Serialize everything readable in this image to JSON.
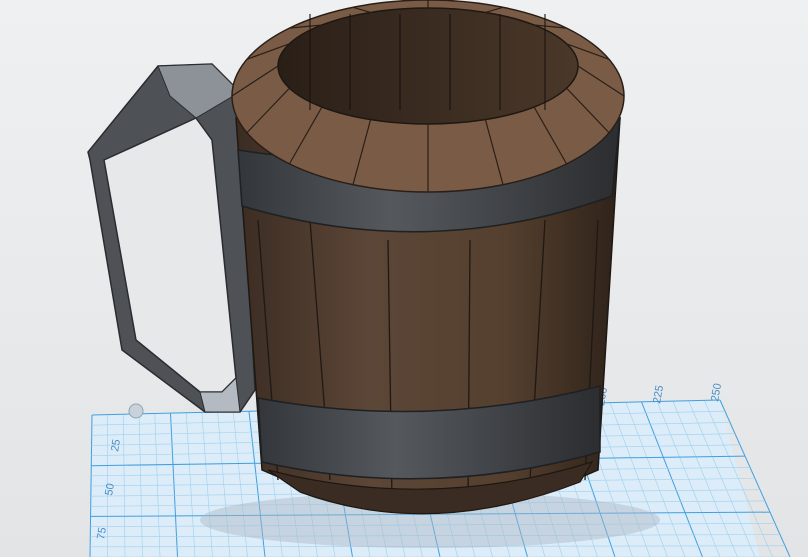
{
  "viewport": {
    "name": "3D design workspace",
    "background": "#e6e8ea"
  },
  "grid": {
    "color_minor": "#9fd0ef",
    "color_major": "#3f9fe0",
    "fill": "#dcecf8",
    "labels": [
      "25",
      "50",
      "75",
      "200",
      "225",
      "250"
    ]
  },
  "model": {
    "name": "Wooden tankard",
    "wood_color": "#5a4434",
    "rim_color": "#7a5c46",
    "band_color": "#4a4d52",
    "handle_color": "#4e5257"
  }
}
